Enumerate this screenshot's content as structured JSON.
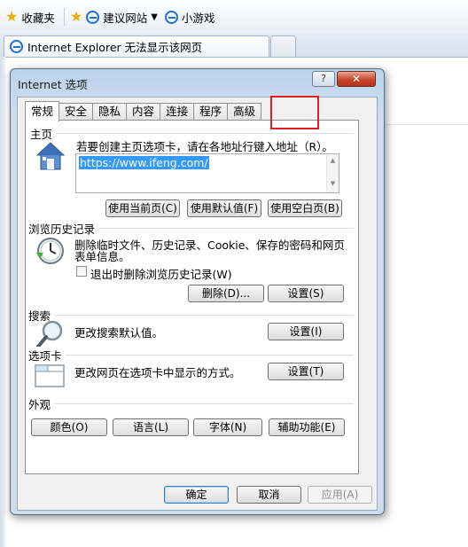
{
  "browser": {
    "favorites_label": "收藏夹",
    "favorites": [
      {
        "label": "建议网站"
      },
      {
        "label": "小游戏"
      }
    ],
    "tab_title": "Internet Explorer 无法显示该网页"
  },
  "dialog": {
    "title": "Internet 选项",
    "help_label": "?",
    "close_label": "✕",
    "tabs": [
      {
        "label": "常规",
        "active": true
      },
      {
        "label": "安全"
      },
      {
        "label": "隐私"
      },
      {
        "label": "内容"
      },
      {
        "label": "连接"
      },
      {
        "label": "程序"
      },
      {
        "label": "高级"
      }
    ],
    "home": {
      "label": "主页",
      "description": "若要创建主页选项卡，请在各地址行键入地址（R）。",
      "url": "https://www.ifeng.com/",
      "buttons": [
        "使用当前页(C)",
        "使用默认值(F)",
        "使用空白页(B)"
      ]
    },
    "history": {
      "label": "浏览历史记录",
      "description_line1": "删除临时文件、历史记录、Cookie、保存的密码和网页",
      "description_line2": "表单信息。",
      "checkbox_label": "退出时删除浏览历史记录(W)",
      "checkbox_checked": false,
      "delete_button": "删除(D)...",
      "settings_button": "设置(S)"
    },
    "search": {
      "label": "搜索",
      "description": "更改搜索默认值。",
      "settings_button": "设置(I)"
    },
    "tabs_section": {
      "label": "选项卡",
      "description": "更改网页在选项卡中显示的方式。",
      "settings_button": "设置(T)"
    },
    "appearance": {
      "label": "外观",
      "buttons": [
        "颜色(O)",
        "语言(L)",
        "字体(N)",
        "辅助功能(E)"
      ]
    },
    "footer": {
      "ok": "确定",
      "cancel": "取消",
      "apply": "应用(A)"
    }
  },
  "colors": {
    "accent": "#3399ff",
    "highlight": "#e02020"
  }
}
